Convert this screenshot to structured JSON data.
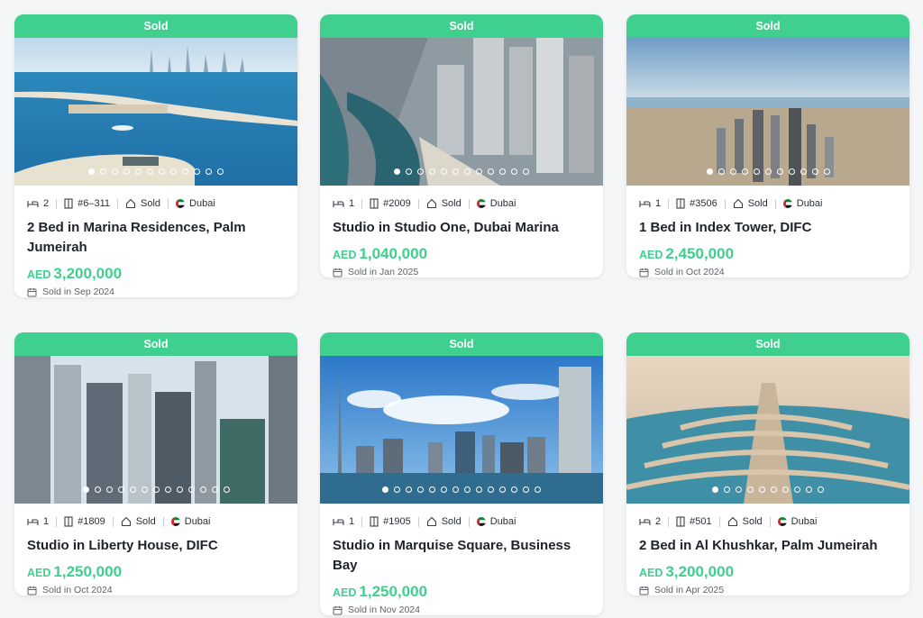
{
  "cards": [
    {
      "badge": "Sold",
      "beds": "2",
      "unit": "#6–311",
      "status": "Sold",
      "city": "Dubai",
      "title": "2 Bed in Marina Residences, Palm Jumeirah",
      "currency": "AED",
      "price": "3,200,000",
      "sold_date": "Sold in Sep 2024",
      "slides": 12,
      "active_slide": 0
    },
    {
      "badge": "Sold",
      "beds": "1",
      "unit": "#2009",
      "status": "Sold",
      "city": "Dubai",
      "title": "Studio in Studio One, Dubai Marina",
      "currency": "AED",
      "price": "1,040,000",
      "sold_date": "Sold in Jan 2025",
      "slides": 12,
      "active_slide": 0
    },
    {
      "badge": "Sold",
      "beds": "1",
      "unit": "#3506",
      "status": "Sold",
      "city": "Dubai",
      "title": "1 Bed in Index Tower, DIFC",
      "currency": "AED",
      "price": "2,450,000",
      "sold_date": "Sold in Oct 2024",
      "slides": 11,
      "active_slide": 0
    },
    {
      "badge": "Sold",
      "beds": "1",
      "unit": "#1809",
      "status": "Sold",
      "city": "Dubai",
      "title": "Studio in Liberty House, DIFC",
      "currency": "AED",
      "price": "1,250,000",
      "sold_date": "Sold in Oct 2024",
      "slides": 13,
      "active_slide": 0
    },
    {
      "badge": "Sold",
      "beds": "1",
      "unit": "#1905",
      "status": "Sold",
      "city": "Dubai",
      "title": "Studio in Marquise Square, Business Bay",
      "currency": "AED",
      "price": "1,250,000",
      "sold_date": "Sold in Nov 2024",
      "slides": 14,
      "active_slide": 0
    },
    {
      "badge": "Sold",
      "beds": "2",
      "unit": "#501",
      "status": "Sold",
      "city": "Dubai",
      "title": "2 Bed in Al Khushkar, Palm Jumeirah",
      "currency": "AED",
      "price": "3,200,000",
      "sold_date": "Sold in Apr 2025",
      "slides": 10,
      "active_slide": 0
    }
  ],
  "colors": {
    "accent": "#3fcf8e",
    "text": "#1f2328",
    "muted": "#5d6369",
    "background": "#f5f6f7"
  },
  "icons": {
    "beds": "bed-icon",
    "unit": "door-icon",
    "status": "house-tag-icon",
    "city": "uae-flag-icon",
    "date": "calendar-icon"
  }
}
